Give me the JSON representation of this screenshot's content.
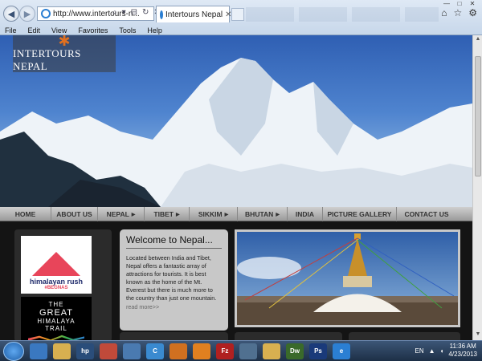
{
  "browser": {
    "address": "http://www.intertours-n...",
    "tab_title": "Intertours Nepal",
    "menu": [
      "File",
      "Edit",
      "View",
      "Favorites",
      "Tools",
      "Help"
    ]
  },
  "site": {
    "logo_text": "INTERTOURS NEPAL",
    "nav": [
      {
        "label": "HOME",
        "dropdown": false
      },
      {
        "label": "ABOUT US",
        "dropdown": false
      },
      {
        "label": "NEPAL",
        "dropdown": true
      },
      {
        "label": "TIBET",
        "dropdown": true
      },
      {
        "label": "SIKKIM",
        "dropdown": true
      },
      {
        "label": "BHUTAN",
        "dropdown": true
      },
      {
        "label": "INDIA",
        "dropdown": false
      },
      {
        "label": "PICTURE GALLERY",
        "dropdown": false
      },
      {
        "label": "CONTACT US",
        "dropdown": false
      }
    ],
    "badges": {
      "rush_title": "himalayan rush",
      "rush_sub": "#BEGNAS",
      "trail_lines": [
        "THE",
        "GREAT",
        "HIMALAYA",
        "TRAIL"
      ]
    },
    "welcome": {
      "title": "Welcome to Nepal...",
      "body": "Located between India and Tibet, Nepal offers a fantastic array of attractions for tourists. It is best known as the home of the Mt. Everest but there is much more to the country than just one mountain.",
      "read_more": "read more>>"
    }
  },
  "taskbar": {
    "lang": "EN",
    "time": "11:36 AM",
    "date": "4/23/2013",
    "apps": [
      {
        "label": "",
        "color": "#3a78c0"
      },
      {
        "label": "",
        "color": "#d8b050"
      },
      {
        "label": "hp",
        "color": "#2a4d7a"
      },
      {
        "label": "",
        "color": "#c04a3a"
      },
      {
        "label": "",
        "color": "#4a7ab0"
      },
      {
        "label": "C",
        "color": "#3a8ad0"
      },
      {
        "label": "",
        "color": "#d07020"
      },
      {
        "label": "",
        "color": "#e08020"
      },
      {
        "label": "Fz",
        "color": "#b02020"
      },
      {
        "label": "",
        "color": "#507090"
      },
      {
        "label": "",
        "color": "#d8b050"
      },
      {
        "label": "Dw",
        "color": "#3a6a2a"
      },
      {
        "label": "Ps",
        "color": "#1a3a7a"
      },
      {
        "label": "e",
        "color": "#2b7fd3"
      }
    ]
  },
  "colors": {
    "page_bg": "#141414",
    "welcome_bg": "#c8c8c8",
    "nav_bg": "#b4b4b4",
    "logo_accent": "#e07020"
  }
}
